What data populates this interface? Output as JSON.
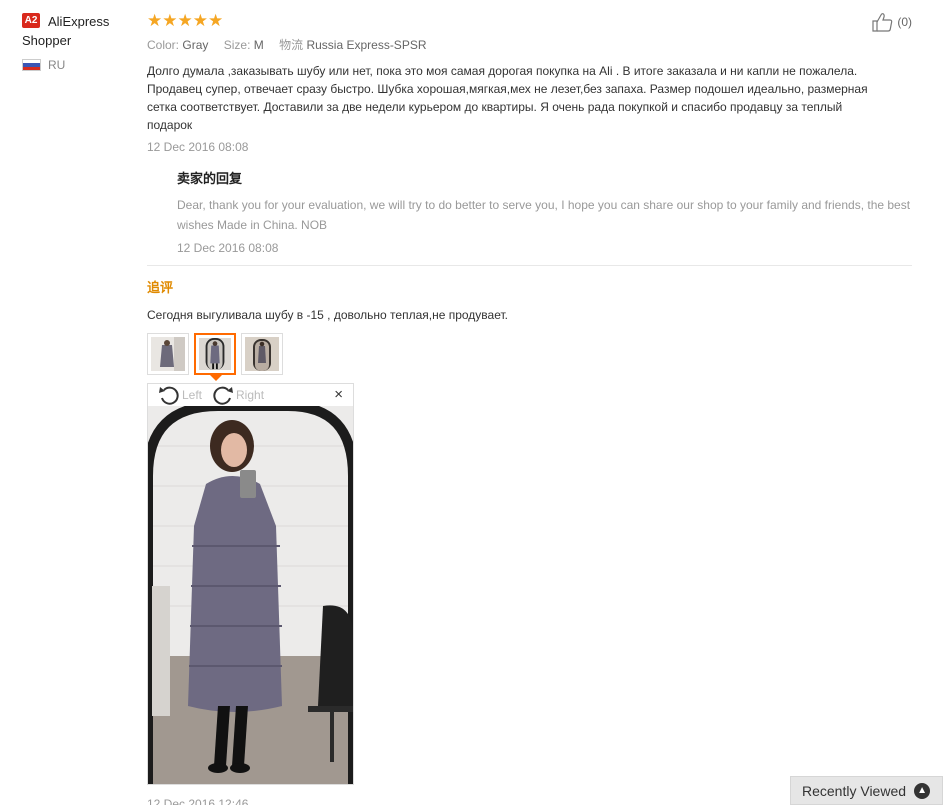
{
  "user": {
    "level_badge": "A2",
    "name": "AliExpress Shopper",
    "country": "RU"
  },
  "review": {
    "stars": "★★★★★",
    "rating": 5,
    "helpful": "(0)",
    "color_label": "Color:",
    "color_value": "Gray",
    "size_label": "Size:",
    "size_value": "M",
    "shipping_label": "物流",
    "shipping_value": "Russia Express-SPSR",
    "text": "Долго думала ,заказывать шубу или нет, пока это моя самая дорогая покупка на Ali . В итоге заказала и ни капли не пожалела. Продавец супер, отвечает сразу быстро. Шубка хорошая,мягкая,мех не лезет,без запаха. Размер подошел идеально, размерная сетка соответствует. Доставили за две недели курьером до квартиры. Я очень рада покупкой и спасибо продавцу за теплый подарок",
    "date": "12 Dec 2016 08:08"
  },
  "seller_reply": {
    "title": "卖家的回复",
    "text": "Dear, thank you for your evaluation, we will try to do better to serve you, I hope you can share our shop to your family and friends, the best wishes Made in China. NOB",
    "date": "12 Dec 2016 08:08"
  },
  "additional": {
    "title": "追评",
    "text": "Сегодня выгуливала шубу в -15 , довольно теплая,не продувает.",
    "date": "12 Dec 2016 12:46"
  },
  "viewer": {
    "rotate_left": "Left",
    "rotate_right": "Right",
    "close": "×"
  },
  "recently_viewed": "Recently Viewed",
  "colors": {
    "star": "#f5a623",
    "accent": "#ff6a00",
    "append_title": "#e08a00",
    "badge": "#d9291c"
  }
}
